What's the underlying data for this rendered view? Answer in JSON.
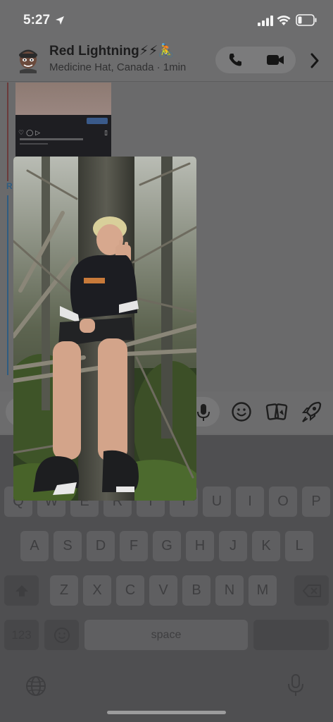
{
  "status_bar": {
    "time": "5:27"
  },
  "chat_header": {
    "contact_name": "Red Lightning⚡⚡🚴",
    "contact_sub": "Medicine Hat, Canada · 1min"
  },
  "chat": {
    "reply_tag": "R"
  },
  "keyboard": {
    "row1": [
      "Q",
      "W",
      "E",
      "R",
      "T",
      "Y",
      "U",
      "I",
      "O",
      "P"
    ],
    "row2": [
      "A",
      "S",
      "D",
      "F",
      "G",
      "H",
      "J",
      "K",
      "L"
    ],
    "row3": [
      "Z",
      "X",
      "C",
      "V",
      "B",
      "N",
      "M"
    ],
    "numbers_label": "123",
    "space_label": "space"
  },
  "colors": {
    "dim_overlay": "#6a6a6b",
    "keyboard_bg": "#4f4f51"
  }
}
